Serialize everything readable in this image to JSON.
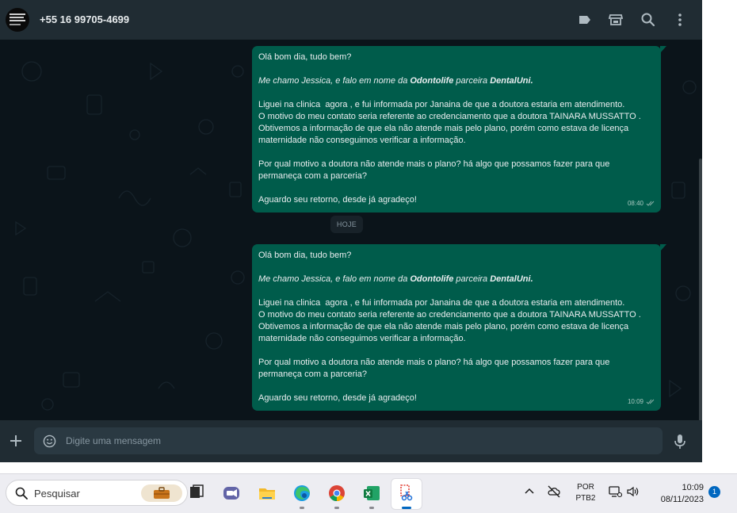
{
  "header": {
    "contact_name": "+55 16 99705-4699",
    "icons": [
      "label-icon",
      "catalog-store-icon",
      "search-icon",
      "more-options-icon"
    ]
  },
  "chat": {
    "date_divider": "HOJE",
    "messages": [
      {
        "time": "08:40",
        "status": "read-double-check",
        "lines": [
          [
            {
              "t": "Olá bom dia, tudo bem?"
            }
          ],
          [],
          [
            {
              "t": "Me chamo Jessica, e falo em nome da ",
              "i": true
            },
            {
              "t": "Odontolife",
              "i": true,
              "b": true
            },
            {
              "t": " parceira ",
              "i": true
            },
            {
              "t": "DentalUni.",
              "i": true,
              "b": true
            }
          ],
          [],
          [
            {
              "t": "Liguei na clinica  agora , e fui informada por Janaina de que a doutora estaria em atendimento."
            }
          ],
          [
            {
              "t": "O motivo do meu contato seria referente ao credenciamento que a doutora TAINARA MUSSATTO ."
            }
          ],
          [
            {
              "t": "Obtivemos a informação de que ela não atende mais pelo plano, porém como estava de licença"
            }
          ],
          [
            {
              "t": "maternidade não conseguimos verificar a informação."
            }
          ],
          [],
          [
            {
              "t": "Por qual motivo a doutora não atende mais o plano? há algo que possamos fazer para que"
            }
          ],
          [
            {
              "t": "permaneça com a parceria?"
            }
          ],
          [],
          [
            {
              "t": "Aguardo seu retorno, desde já agradeço!"
            }
          ]
        ]
      },
      {
        "time": "10:09",
        "status": "read-double-check",
        "lines": [
          [
            {
              "t": "Olá bom dia, tudo bem?"
            }
          ],
          [],
          [
            {
              "t": "Me chamo Jessica, e falo em nome da ",
              "i": true
            },
            {
              "t": "Odontolife",
              "i": true,
              "b": true
            },
            {
              "t": " parceira ",
              "i": true
            },
            {
              "t": "DentalUni.",
              "i": true,
              "b": true
            }
          ],
          [],
          [
            {
              "t": "Liguei na clinica  agora , e fui informada por Janaina de que a doutora estaria em atendimento."
            }
          ],
          [
            {
              "t": "O motivo do meu contato seria referente ao credenciamento que a doutora TAINARA MUSSATTO ."
            }
          ],
          [
            {
              "t": "Obtivemos a informação de que ela não atende mais pelo plano, porém como estava de licença"
            }
          ],
          [
            {
              "t": "maternidade não conseguimos verificar a informação."
            }
          ],
          [],
          [
            {
              "t": "Por qual motivo a doutora não atende mais o plano? há algo que possamos fazer para que"
            }
          ],
          [
            {
              "t": "permaneça com a parceria?"
            }
          ],
          [],
          [
            {
              "t": "Aguardo seu retorno, desde já agradeço!"
            }
          ]
        ]
      }
    ]
  },
  "footer": {
    "message_placeholder": "Digite uma mensagem",
    "icons": [
      "attach-plus-icon",
      "emoji-icon",
      "microphone-icon"
    ]
  },
  "taskbar": {
    "search_placeholder": "Pesquisar",
    "apps": [
      {
        "name": "task-view-app",
        "icon": "task-view-icon",
        "active": false,
        "running": false
      },
      {
        "name": "teams-app",
        "icon": "teams-icon",
        "active": false,
        "running": false
      },
      {
        "name": "file-explorer-app",
        "icon": "folder-icon",
        "active": false,
        "running": false
      },
      {
        "name": "edge-app",
        "icon": "edge-icon",
        "active": false,
        "running": true
      },
      {
        "name": "chrome-app",
        "icon": "chrome-icon",
        "active": false,
        "running": true
      },
      {
        "name": "excel-app",
        "icon": "excel-icon",
        "active": false,
        "running": true
      },
      {
        "name": "snipping-tool-app",
        "icon": "snipping-tool-icon",
        "active": true,
        "running": true
      }
    ],
    "tray": {
      "icons": [
        "chevron-up-icon",
        "cloud-offline-icon",
        "display-icon",
        "volume-icon"
      ],
      "language": "POR",
      "keyboard": "PTB2",
      "time": "10:09",
      "date": "08/11/2023",
      "notification_count": "1"
    }
  },
  "colors": {
    "header_bg": "#202c33",
    "chat_bg": "#0b141a",
    "outgoing_bubble": "#005c4b",
    "text_primary": "#e9edef",
    "text_secondary": "#8696a0",
    "taskbar_bg": "#ededf2",
    "accent": "#0067c0"
  }
}
